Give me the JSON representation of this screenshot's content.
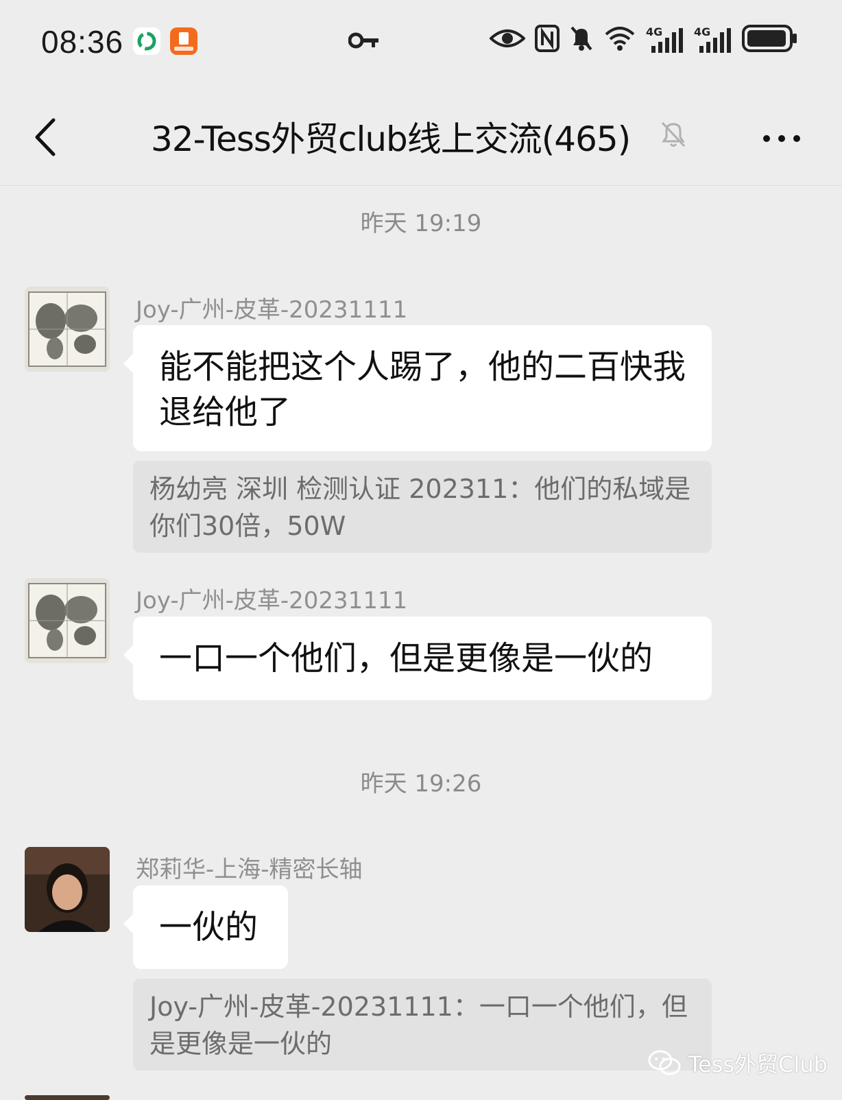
{
  "status_bar": {
    "time": "08:36",
    "network_1": "4G",
    "network_2": "4G"
  },
  "header": {
    "title": "32-Tess外贸club线上交流(465)"
  },
  "messages": [
    {
      "timestamp": "昨天 19:19",
      "sender": "Joy-广州-皮革-20231111",
      "text": "能不能把这个人踢了，他的二百快我退给他了",
      "quote": "杨幼亮 深圳 检测认证 202311：他们的私域是你们30倍，50W"
    },
    {
      "sender": "Joy-广州-皮革-20231111",
      "text": "一口一个他们，但是更像是一伙的"
    },
    {
      "timestamp": "昨天 19:26",
      "sender": "郑莉华-上海-精密长轴",
      "text": "一伙的",
      "quote": "Joy-广州-皮革-20231111：一口一个他们，但是更像是一伙的"
    }
  ],
  "watermark": {
    "text": "Tess外贸Club"
  }
}
